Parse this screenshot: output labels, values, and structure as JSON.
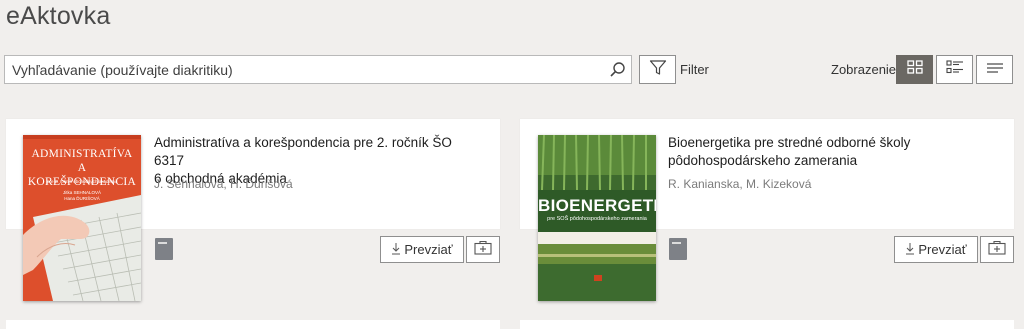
{
  "app": {
    "title": "eAktovka"
  },
  "search": {
    "placeholder": "Vyhľadávanie (používajte diakritiku)"
  },
  "toolbar": {
    "filter_label": "Filter",
    "view_label": "Zobrazenie"
  },
  "books": [
    {
      "title": "Administratíva a korešpondencia pre 2. ročník ŠO 6317\n6 obchodná akadémia",
      "authors": "J. Sehnalová, H. Ďurišová",
      "download_label": "Prevziať",
      "cover": {
        "title": "ADMINISTRATÍVA\nA KOREŠPONDENCIA",
        "subtitle": "pre 2. ročník obchodných akadémií",
        "authors": "Jitka SEHNALOVÁ\nHana ĎURIŠOVÁ"
      }
    },
    {
      "title": "Bioenergetika pre stredné odborné školy\npôdohospodárskeho zamerania",
      "authors": "R. Kanianska, M. Kizeková",
      "download_label": "Prevziať",
      "cover": {
        "title": "BIOENERGETIKA",
        "subtitle": "pre SOŠ pôdohospodárskeho zamerania"
      }
    }
  ],
  "colors": {
    "accent_dark": "#6b6863",
    "background": "#f1efed"
  }
}
